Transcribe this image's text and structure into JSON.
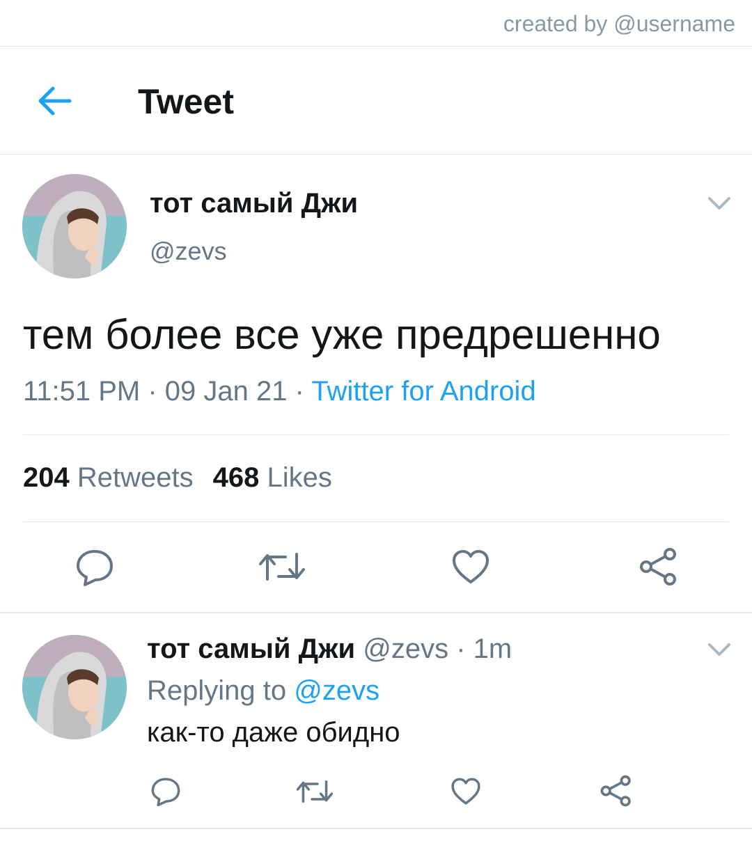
{
  "watermark": "created by @username",
  "header": {
    "title": "Tweet",
    "back_icon": "arrow-left-icon"
  },
  "colors": {
    "accent": "#1da1f2",
    "text": "#14171a",
    "secondary": "#657786",
    "divider": "#e1e8ed"
  },
  "tweet": {
    "name": "тот самый Джи",
    "handle": "@zevs",
    "text": "тем более все уже предрешенно",
    "time": "11:51 PM",
    "date": "09 Jan 21",
    "sep": " · ",
    "source": "Twitter for Android",
    "retweets_count": "204",
    "retweets_label": "Retweets",
    "likes_count": "468",
    "likes_label": "Likes",
    "actions": [
      "reply-icon",
      "retweet-icon",
      "like-icon",
      "share-icon"
    ]
  },
  "reply": {
    "name": "тот самый Джи",
    "handle": "@zevs",
    "time_sep": " · ",
    "time": "1m",
    "replying_label": "Replying to",
    "replying_to": "@zevs",
    "text": "как-то даже обидно",
    "actions": [
      "reply-icon",
      "retweet-icon",
      "like-icon",
      "share-icon"
    ]
  }
}
